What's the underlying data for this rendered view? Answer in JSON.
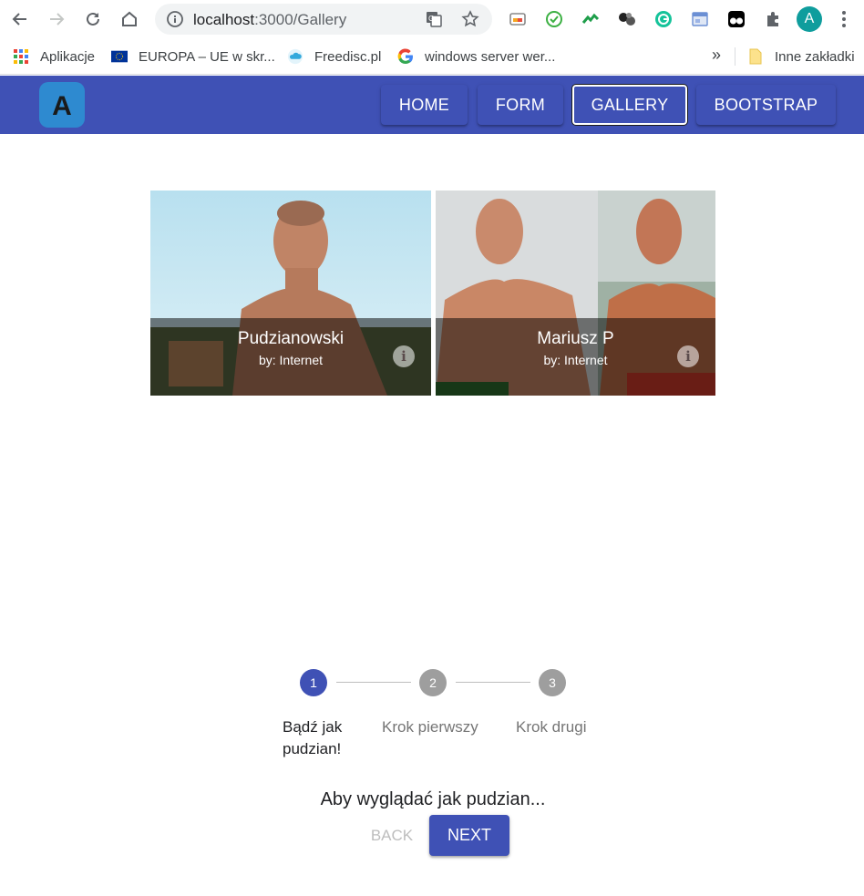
{
  "browser": {
    "url_host": "localhost",
    "url_path": ":3000/Gallery",
    "avatar_letter": "A",
    "bookmarks": [
      {
        "label": "Aplikacje",
        "icon": "apps-grid-icon"
      },
      {
        "label": "EUROPA – UE w skr...",
        "icon": "eu-flag-icon"
      },
      {
        "label": "Freedisc.pl",
        "icon": "cloud-icon"
      },
      {
        "label": "windows server wer...",
        "icon": "google-icon"
      }
    ],
    "more_label": "»",
    "other_bookmarks": "Inne zakładki"
  },
  "app": {
    "logo_letter": "A",
    "nav": [
      {
        "label": "HOME",
        "active": false
      },
      {
        "label": "FORM",
        "active": false
      },
      {
        "label": "GALLERY",
        "active": true
      },
      {
        "label": "BOOTSTRAP",
        "active": false
      }
    ]
  },
  "gallery": [
    {
      "title": "Pudzianowski",
      "author": "by: Internet"
    },
    {
      "title": "Mariusz P",
      "author": "by: Internet"
    }
  ],
  "stepper": {
    "active_step": 1,
    "steps": [
      {
        "number": "1",
        "label": "Bądź jak pudzian!"
      },
      {
        "number": "2",
        "label": "Krok pierwszy"
      },
      {
        "number": "3",
        "label": "Krok drugi"
      }
    ],
    "content": "Aby wyglądać jak pudzian...",
    "back_label": "BACK",
    "next_label": "NEXT"
  },
  "colors": {
    "primary": "#3f51b5",
    "inactive_step": "#9e9e9e"
  }
}
